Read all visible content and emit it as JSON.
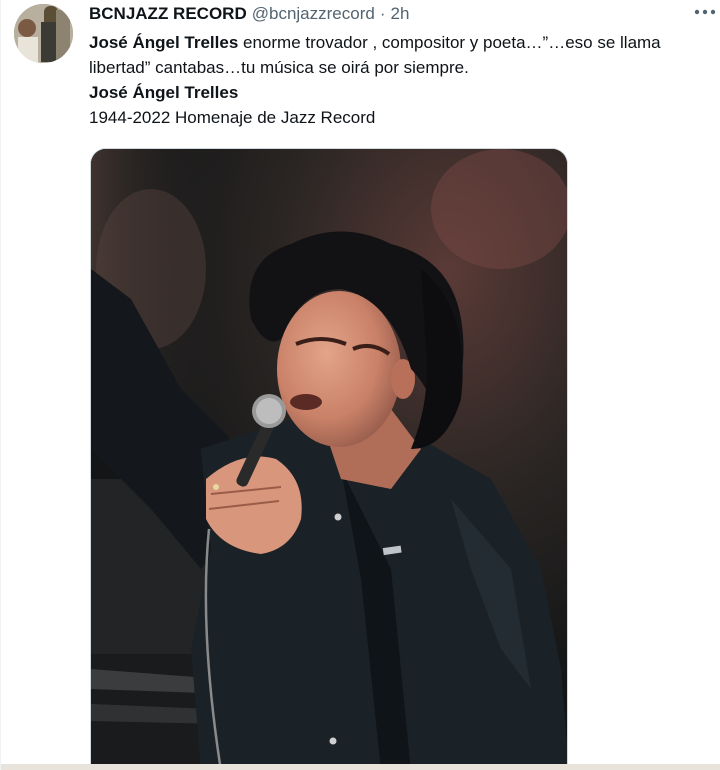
{
  "tweet": {
    "display_name": "BCNJAZZ RECORD",
    "handle": "@bcnjazzrecord",
    "separator": "·",
    "time": "2h",
    "more_icon": "ellipsis-horizontal-icon",
    "text": {
      "line1_bold": "José Ángel Trelles",
      "line1_rest": " enorme trovador , compositor y poeta…”…eso se llama libertad” cantabas…tu música se oirá por siempre.",
      "line2_bold": "José Ángel Trelles",
      "line3": "1944-2022 Homenaje de Jazz Record"
    }
  }
}
